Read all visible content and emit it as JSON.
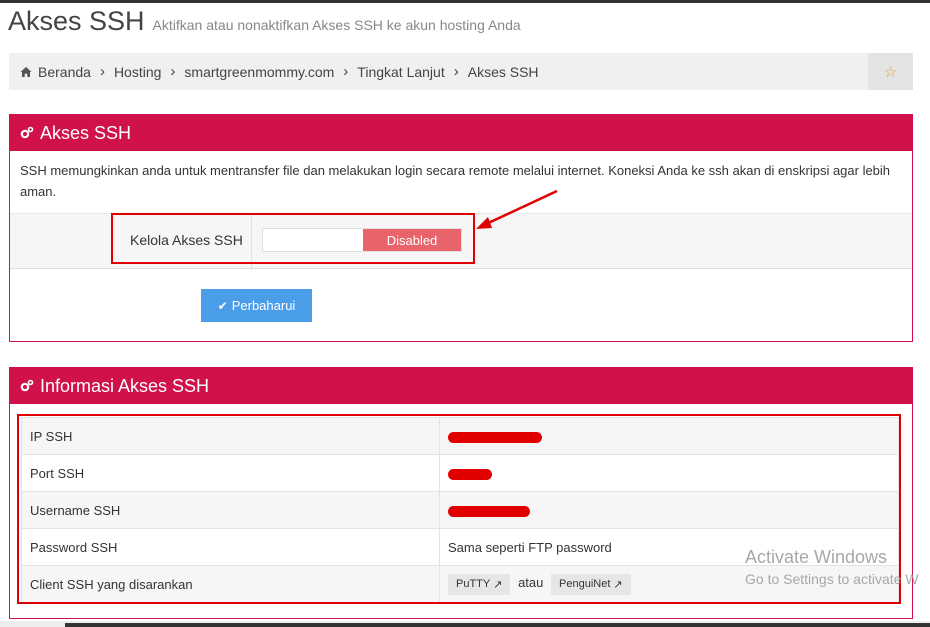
{
  "header": {
    "title": "Akses SSH",
    "subtitle": "Aktifkan atau nonaktifkan Akses SSH ke akun hosting Anda"
  },
  "breadcrumb": [
    "Beranda",
    "Hosting",
    "smartgreenmommy.com",
    "Tingkat Lanjut",
    "Akses SSH"
  ],
  "favorite_icon": "star-icon",
  "panel_ssh": {
    "title": "Akses SSH",
    "description": "SSH memungkinkan anda untuk mentransfer file dan melakukan login secara remote melalui internet. Koneksi Anda ke ssh akan di enskripsi agar lebih aman.",
    "manage_label": "Kelola Akses SSH",
    "toggle_state": "Disabled",
    "update_button": "Perbaharui"
  },
  "panel_info": {
    "title": "Informasi Akses SSH",
    "rows": [
      {
        "label": "IP SSH",
        "value": ""
      },
      {
        "label": "Port SSH",
        "value": ""
      },
      {
        "label": "Username SSH",
        "value": ""
      },
      {
        "label": "Password SSH",
        "value": "Sama seperti FTP password"
      },
      {
        "label": "Client SSH yang disarankan",
        "value": ""
      }
    ],
    "clients": [
      "PuTTY",
      "PenguiNet"
    ],
    "or_text": "atau"
  },
  "watermark": {
    "line1": "Activate Windows",
    "line2": "Go to Settings to activate W"
  },
  "colors": {
    "panel_header": "#d0114a",
    "toggle_disabled": "#e8636a",
    "update_button": "#4a9de8",
    "annotation": "#e00000"
  }
}
